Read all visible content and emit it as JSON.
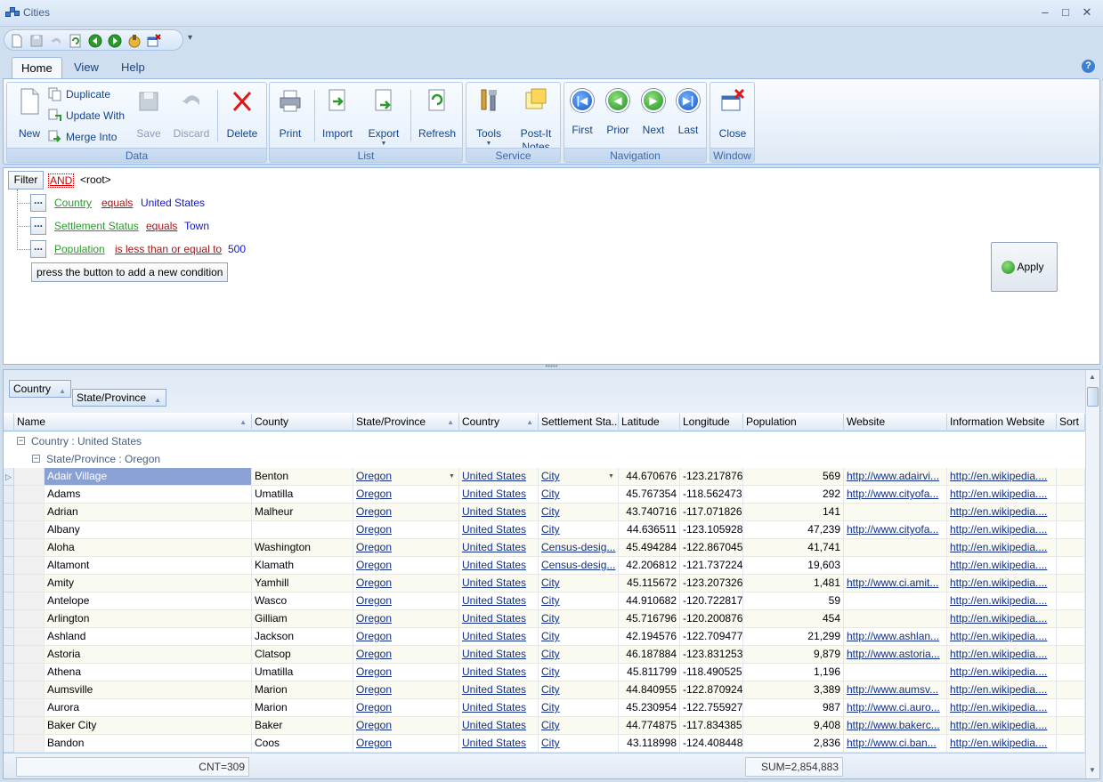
{
  "window": {
    "title": "Cities",
    "minimize": "–",
    "maximize": "□",
    "close": "✕"
  },
  "quick_access": {
    "more": "▾",
    "icons": [
      "new-doc-icon",
      "save-icon",
      "undo-icon",
      "refresh-icon",
      "prior-icon",
      "next-icon",
      "tools-icon",
      "close-icon"
    ]
  },
  "ribbon": {
    "tabs": [
      "Home",
      "View",
      "Help"
    ],
    "help": "?",
    "groups": {
      "data": {
        "label": "Data",
        "new": "New",
        "duplicate": "Duplicate",
        "update_with": "Update With",
        "merge_into": "Merge Into",
        "save": "Save",
        "discard": "Discard",
        "delete": "Delete"
      },
      "list": {
        "label": "List",
        "print": "Print",
        "import": "Import",
        "export": "Export",
        "refresh": "Refresh"
      },
      "service": {
        "label": "Service",
        "tools": "Tools",
        "post_it_line1": "Post-It",
        "post_it_line2": "Notes"
      },
      "navigation": {
        "label": "Navigation",
        "first": "First",
        "prior": "Prior",
        "next": "Next",
        "last": "Last"
      },
      "window": {
        "label": "Window",
        "close": "Close"
      }
    }
  },
  "filter": {
    "button": "Filter",
    "logic": "AND",
    "root": "<root>",
    "dots": "...",
    "conditions": [
      {
        "field": "Country",
        "operator": "equals",
        "value": "United States"
      },
      {
        "field": "Settlement Status",
        "operator": "equals",
        "value": "Town"
      },
      {
        "field": "Population",
        "operator": "is less than or equal to",
        "value": "500"
      }
    ],
    "add_hint": "press the button to add a new condition",
    "apply": "Apply"
  },
  "grid": {
    "group_by": [
      "Country",
      "State/Province"
    ],
    "columns": [
      "Name",
      "County",
      "State/Province",
      "Country",
      "Settlement Sta...",
      "Latitude",
      "Longitude",
      "Population",
      "Website",
      "Information Website",
      "Sort"
    ],
    "group_country": "Country : United States",
    "group_state": "State/Province : Oregon",
    "rows": [
      [
        "Adair Village",
        "Benton",
        "Oregon",
        "United States",
        "City",
        "44.670676",
        "-123.217876",
        "569",
        "http://www.adairvi...",
        "http://en.wikipedia...."
      ],
      [
        "Adams",
        "Umatilla",
        "Oregon",
        "United States",
        "City",
        "45.767354",
        "-118.562473",
        "292",
        "http://www.cityofa...",
        "http://en.wikipedia...."
      ],
      [
        "Adrian",
        "Malheur",
        "Oregon",
        "United States",
        "City",
        "43.740716",
        "-117.071826",
        "141",
        "",
        "http://en.wikipedia...."
      ],
      [
        "Albany",
        "",
        "Oregon",
        "United States",
        "City",
        "44.636511",
        "-123.105928",
        "47,239",
        "http://www.cityofa...",
        "http://en.wikipedia...."
      ],
      [
        "Aloha",
        "Washington",
        "Oregon",
        "United States",
        "Census-desig...",
        "45.494284",
        "-122.867045",
        "41,741",
        "",
        "http://en.wikipedia...."
      ],
      [
        "Altamont",
        "Klamath",
        "Oregon",
        "United States",
        "Census-desig...",
        "42.206812",
        "-121.737224",
        "19,603",
        "",
        "http://en.wikipedia...."
      ],
      [
        "Amity",
        "Yamhill",
        "Oregon",
        "United States",
        "City",
        "45.115672",
        "-123.207326",
        "1,481",
        "http://www.ci.amit...",
        "http://en.wikipedia...."
      ],
      [
        "Antelope",
        "Wasco",
        "Oregon",
        "United States",
        "City",
        "44.910682",
        "-120.722817",
        "59",
        "",
        "http://en.wikipedia...."
      ],
      [
        "Arlington",
        "Gilliam",
        "Oregon",
        "United States",
        "City",
        "45.716796",
        "-120.200876",
        "454",
        "",
        "http://en.wikipedia...."
      ],
      [
        "Ashland",
        "Jackson",
        "Oregon",
        "United States",
        "City",
        "42.194576",
        "-122.709477",
        "21,299",
        "http://www.ashlan...",
        "http://en.wikipedia...."
      ],
      [
        "Astoria",
        "Clatsop",
        "Oregon",
        "United States",
        "City",
        "46.187884",
        "-123.831253",
        "9,879",
        "http://www.astoria...",
        "http://en.wikipedia...."
      ],
      [
        "Athena",
        "Umatilla",
        "Oregon",
        "United States",
        "City",
        "45.811799",
        "-118.490525",
        "1,196",
        "",
        "http://en.wikipedia...."
      ],
      [
        "Aumsville",
        "Marion",
        "Oregon",
        "United States",
        "City",
        "44.840955",
        "-122.870924",
        "3,389",
        "http://www.aumsv...",
        "http://en.wikipedia...."
      ],
      [
        "Aurora",
        "Marion",
        "Oregon",
        "United States",
        "City",
        "45.230954",
        "-122.755927",
        "987",
        "http://www.ci.auro...",
        "http://en.wikipedia...."
      ],
      [
        "Baker City",
        "Baker",
        "Oregon",
        "United States",
        "City",
        "44.774875",
        "-117.834385",
        "9,408",
        "http://www.bakerc...",
        "http://en.wikipedia...."
      ],
      [
        "Bandon",
        "Coos",
        "Oregon",
        "United States",
        "City",
        "43.118998",
        "-124.408448",
        "2,836",
        "http://www.ci.ban...",
        "http://en.wikipedia...."
      ]
    ],
    "footer_count": "CNT=309",
    "footer_sum": "SUM=2,854,883"
  }
}
